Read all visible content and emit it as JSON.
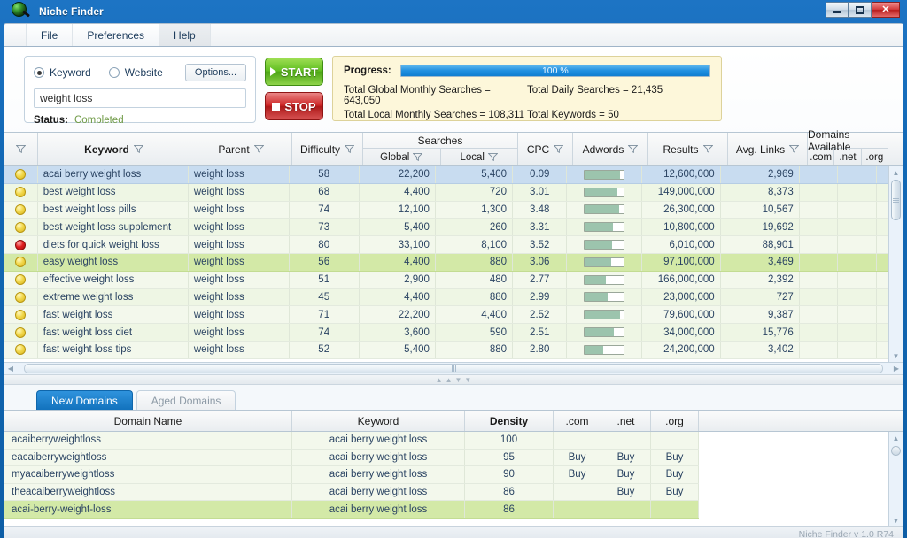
{
  "window": {
    "title": "Niche Finder",
    "logo_icon": "app-logo-icon",
    "minimize_label": "Minimize",
    "maximize_label": "Maximize",
    "close_label": "✕"
  },
  "menu": {
    "items": [
      {
        "label": "File"
      },
      {
        "label": "Preferences"
      },
      {
        "label": "Help"
      }
    ]
  },
  "search_panel": {
    "mode_keyword": "Keyword",
    "mode_website": "Website",
    "options_label": "Options...",
    "query_value": "weight loss",
    "query_placeholder": "",
    "status_label": "Status:",
    "status_value": "Completed"
  },
  "run_controls": {
    "start_label": "START",
    "stop_label": "STOP"
  },
  "progress_panel": {
    "progress_label": "Progress:",
    "percent_text": "100 %",
    "percent_value": 100,
    "stats": [
      "Total Global Monthly Searches =  643,050",
      "Total Daily Searches =  21,435",
      "Total Local Monthly Searches =  108,311",
      "Total Keywords =  50"
    ]
  },
  "keyword_grid": {
    "headers": {
      "status": "",
      "keyword": "Keyword",
      "parent": "Parent",
      "difficulty": "Difficulty",
      "searches": "Searches",
      "global": "Global",
      "local": "Local",
      "cpc": "CPC",
      "adwords": "Adwords",
      "results": "Results",
      "avg_links": "Avg. Links",
      "domains_available": "Domains Available",
      "com": ".com",
      "net": ".net",
      "org": ".org"
    },
    "rows": [
      {
        "status": "yellow",
        "keyword": "acai berry weight loss",
        "parent": "weight loss",
        "difficulty": "58",
        "global": "22,200",
        "local": "5,400",
        "cpc": "0.09",
        "adwords": 92,
        "results": "12,600,000",
        "avg_links": "2,969",
        "state": "selected"
      },
      {
        "status": "yellow",
        "keyword": "best weight loss",
        "parent": "weight loss",
        "difficulty": "68",
        "global": "4,400",
        "local": "720",
        "cpc": "3.01",
        "adwords": 85,
        "results": "149,000,000",
        "avg_links": "8,373",
        "state": "normal"
      },
      {
        "status": "yellow",
        "keyword": "best weight loss pills",
        "parent": "weight loss",
        "difficulty": "74",
        "global": "12,100",
        "local": "1,300",
        "cpc": "3.48",
        "adwords": 88,
        "results": "26,300,000",
        "avg_links": "10,567",
        "state": "normal"
      },
      {
        "status": "yellow",
        "keyword": "best weight loss supplement",
        "parent": "weight loss",
        "difficulty": "73",
        "global": "5,400",
        "local": "260",
        "cpc": "3.31",
        "adwords": 72,
        "results": "10,800,000",
        "avg_links": "19,692",
        "state": "normal"
      },
      {
        "status": "red",
        "keyword": "diets for quick weight loss",
        "parent": "weight loss",
        "difficulty": "80",
        "global": "33,100",
        "local": "8,100",
        "cpc": "3.52",
        "adwords": 70,
        "results": "6,010,000",
        "avg_links": "88,901",
        "state": "normal"
      },
      {
        "status": "yellow",
        "keyword": "easy weight loss",
        "parent": "weight loss",
        "difficulty": "56",
        "global": "4,400",
        "local": "880",
        "cpc": "3.06",
        "adwords": 68,
        "results": "97,100,000",
        "avg_links": "3,469",
        "state": "highlight"
      },
      {
        "status": "yellow",
        "keyword": "effective weight loss",
        "parent": "weight loss",
        "difficulty": "51",
        "global": "2,900",
        "local": "480",
        "cpc": "2.77",
        "adwords": 55,
        "results": "166,000,000",
        "avg_links": "2,392",
        "state": "normal"
      },
      {
        "status": "yellow",
        "keyword": "extreme weight loss",
        "parent": "weight loss",
        "difficulty": "45",
        "global": "4,400",
        "local": "880",
        "cpc": "2.99",
        "adwords": 58,
        "results": "23,000,000",
        "avg_links": "727",
        "state": "normal"
      },
      {
        "status": "yellow",
        "keyword": "fast weight loss",
        "parent": "weight loss",
        "difficulty": "71",
        "global": "22,200",
        "local": "4,400",
        "cpc": "2.52",
        "adwords": 90,
        "results": "79,600,000",
        "avg_links": "9,387",
        "state": "normal"
      },
      {
        "status": "yellow",
        "keyword": "fast weight loss diet",
        "parent": "weight loss",
        "difficulty": "74",
        "global": "3,600",
        "local": "590",
        "cpc": "2.51",
        "adwords": 75,
        "results": "34,000,000",
        "avg_links": "15,776",
        "state": "normal"
      },
      {
        "status": "yellow",
        "keyword": "fast weight loss tips",
        "parent": "weight loss",
        "difficulty": "52",
        "global": "5,400",
        "local": "880",
        "cpc": "2.80",
        "adwords": 48,
        "results": "24,200,000",
        "avg_links": "3,402",
        "state": "normal"
      }
    ]
  },
  "domain_panel": {
    "tabs": [
      {
        "label": "New Domains",
        "active": true
      },
      {
        "label": "Aged Domains",
        "active": false
      }
    ],
    "headers": {
      "domain_name": "Domain Name",
      "keyword": "Keyword",
      "density": "Density",
      "com": ".com",
      "net": ".net",
      "org": ".org"
    },
    "buy_label": "Buy",
    "rows": [
      {
        "domain": "acaiberryweightloss",
        "keyword": "acai berry weight loss",
        "density": "100",
        "com": "",
        "net": "",
        "org": "",
        "state": "normal"
      },
      {
        "domain": "eacaiberryweightloss",
        "keyword": "acai berry weight loss",
        "density": "95",
        "com": "Buy",
        "net": "Buy",
        "org": "Buy",
        "state": "normal"
      },
      {
        "domain": "myacaiberryweightloss",
        "keyword": "acai berry weight loss",
        "density": "90",
        "com": "Buy",
        "net": "Buy",
        "org": "Buy",
        "state": "normal"
      },
      {
        "domain": "theacaiberryweightloss",
        "keyword": "acai berry weight loss",
        "density": "86",
        "com": "",
        "net": "Buy",
        "org": "Buy",
        "state": "normal"
      },
      {
        "domain": "acai-berry-weight-loss",
        "keyword": "acai berry weight loss",
        "density": "86",
        "com": "",
        "net": "",
        "org": "",
        "state": "highlight"
      }
    ]
  },
  "statusbar": {
    "version": "Niche Finder v 1.0 R74"
  },
  "colors": {
    "accent_blue": "#1272bd",
    "window_chrome": "#0d5ea6",
    "status_ok": "#6f9a46",
    "row_selected": "#c8dcf0",
    "row_highlight": "#d3e9a7",
    "adwords_bar": "#9cc4ad"
  }
}
